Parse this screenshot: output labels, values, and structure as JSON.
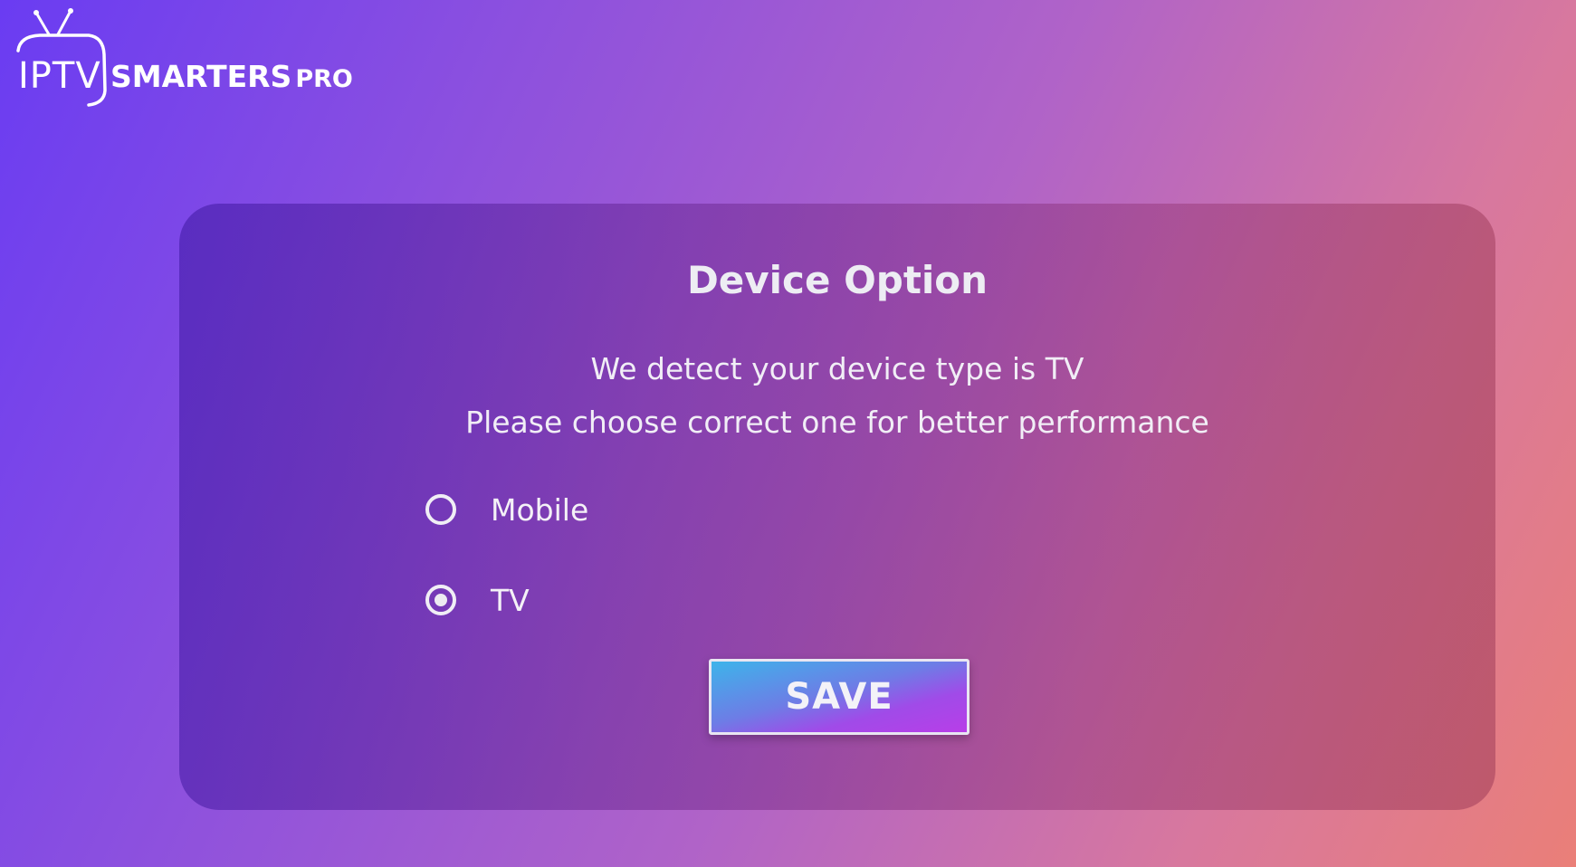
{
  "logo": {
    "iptv_text": "IPTV",
    "smarters_text": "SMARTERS",
    "pro_text": "PRO",
    "icon": "tv-antenna-icon"
  },
  "dialog": {
    "title": "Device Option",
    "message_line1": "We detect your device type is TV",
    "message_line2": "Please choose correct one for better performance",
    "options": [
      {
        "label": "Mobile",
        "selected": false
      },
      {
        "label": "TV",
        "selected": true
      }
    ],
    "save_label": "SAVE"
  },
  "colors": {
    "background_start": "#6a3cf2",
    "background_end": "#ea7f78",
    "save_gradient_start": "#3db4ea",
    "save_gradient_end": "#b83ee8"
  }
}
